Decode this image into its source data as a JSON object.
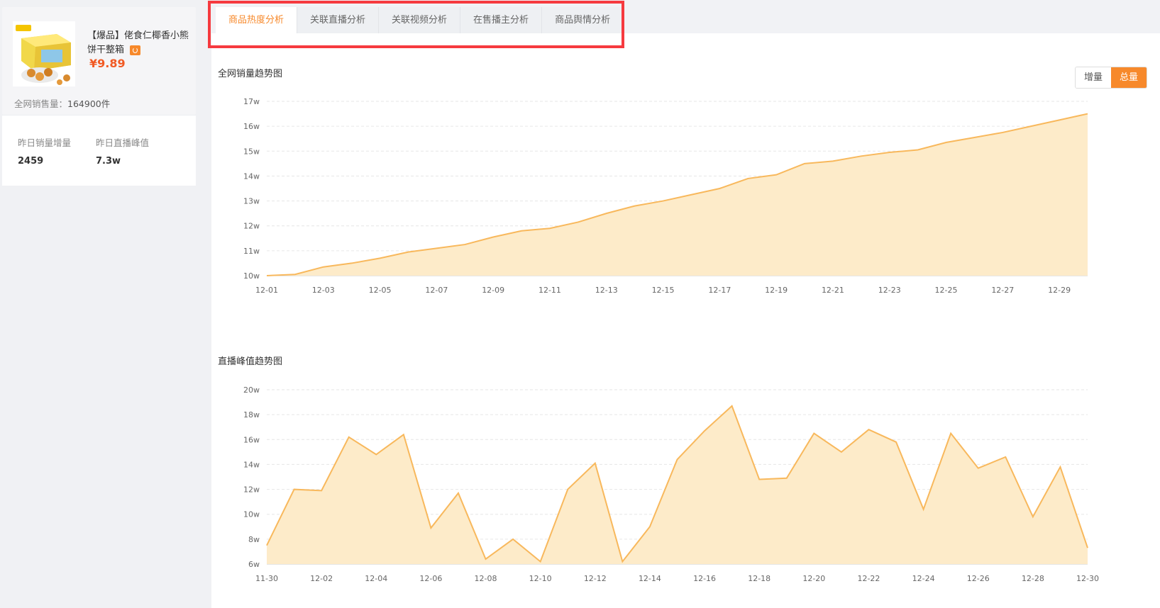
{
  "product": {
    "title": "【爆品】佬食仁椰香小熊饼干整箱",
    "price": "¥9.89",
    "sales_label": "全网销售量：",
    "sales_value": "164900件",
    "stats": [
      {
        "label": "昨日销量增量",
        "value": "2459"
      },
      {
        "label": "昨日直播峰值",
        "value": "7.3w"
      }
    ]
  },
  "tabs": [
    {
      "label": "商品热度分析",
      "active": true
    },
    {
      "label": "关联直播分析",
      "active": false
    },
    {
      "label": "关联视频分析",
      "active": false
    },
    {
      "label": "在售播主分析",
      "active": false
    },
    {
      "label": "商品舆情分析",
      "active": false
    }
  ],
  "toggle": {
    "increment": "增量",
    "total": "总量",
    "selected": "total"
  },
  "colors": {
    "accent": "#f7892b",
    "area_fill": "#fdebc9",
    "line": "#f8b85c",
    "highlight": "#f63a3f"
  },
  "chart_data": [
    {
      "type": "area",
      "title": "全网销量趋势图",
      "x": [
        "12-01",
        "12-02",
        "12-03",
        "12-04",
        "12-05",
        "12-06",
        "12-07",
        "12-08",
        "12-09",
        "12-10",
        "12-11",
        "12-12",
        "12-13",
        "12-14",
        "12-15",
        "12-16",
        "12-17",
        "12-18",
        "12-19",
        "12-20",
        "12-21",
        "12-22",
        "12-23",
        "12-24",
        "12-25",
        "12-26",
        "12-27",
        "12-28",
        "12-29",
        "12-30"
      ],
      "tick_labels": [
        "12-01",
        "12-03",
        "12-05",
        "12-07",
        "12-09",
        "12-11",
        "12-13",
        "12-15",
        "12-17",
        "12-19",
        "12-21",
        "12-23",
        "12-25",
        "12-27",
        "12-29"
      ],
      "values": [
        10.0,
        10.05,
        10.35,
        10.5,
        10.7,
        10.95,
        11.1,
        11.25,
        11.55,
        11.8,
        11.9,
        12.15,
        12.5,
        12.8,
        13.0,
        13.25,
        13.5,
        13.9,
        14.05,
        14.5,
        14.6,
        14.8,
        14.95,
        15.05,
        15.35,
        15.55,
        15.75,
        16.0,
        16.25,
        16.5
      ],
      "y_ticks": [
        "10w",
        "11w",
        "12w",
        "13w",
        "14w",
        "15w",
        "16w",
        "17w"
      ],
      "ylim": [
        10,
        17
      ],
      "unit": "w",
      "grid": true
    },
    {
      "type": "area",
      "title": "直播峰值趋势图",
      "x": [
        "11-30",
        "12-01",
        "12-02",
        "12-03",
        "12-04",
        "12-05",
        "12-06",
        "12-07",
        "12-08",
        "12-09",
        "12-10",
        "12-11",
        "12-12",
        "12-13",
        "12-14",
        "12-15",
        "12-16",
        "12-17",
        "12-18",
        "12-19",
        "12-20",
        "12-21",
        "12-22",
        "12-23",
        "12-24",
        "12-25",
        "12-26",
        "12-27",
        "12-28",
        "12-29",
        "12-30"
      ],
      "tick_labels": [
        "11-30",
        "12-02",
        "12-04",
        "12-06",
        "12-08",
        "12-10",
        "12-12",
        "12-14",
        "12-16",
        "12-18",
        "12-20",
        "12-22",
        "12-24",
        "12-26",
        "12-28",
        "12-30"
      ],
      "values": [
        7.5,
        12.0,
        11.9,
        16.2,
        14.8,
        16.4,
        8.9,
        11.7,
        6.4,
        8.0,
        6.2,
        12.0,
        14.1,
        6.2,
        9.0,
        14.4,
        16.7,
        18.7,
        12.8,
        12.9,
        16.5,
        15.0,
        16.8,
        15.8,
        10.4,
        16.5,
        13.7,
        14.6,
        9.8,
        13.8,
        7.3
      ],
      "y_ticks": [
        "6w",
        "8w",
        "10w",
        "12w",
        "14w",
        "16w",
        "18w",
        "20w"
      ],
      "ylim": [
        6,
        20
      ],
      "unit": "w",
      "grid": true
    }
  ]
}
